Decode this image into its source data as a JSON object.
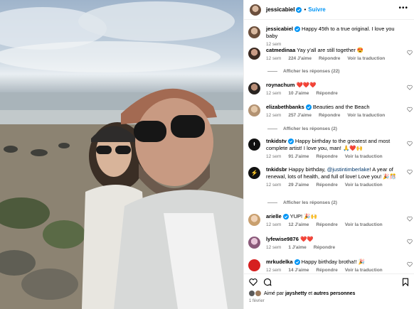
{
  "post": {
    "author": "jessicabiel",
    "follow_label": "Suivre",
    "caption": "Happy 45th to a true original. I love you baby",
    "caption_time": "12 sem"
  },
  "comments": [
    {
      "user": "catmedinaa",
      "text": "Yay y'all are still together 😍",
      "time": "12 sem",
      "likes": "224 J'aime",
      "reply": "Répondre",
      "translate": "Voir la traduction",
      "replies": "Afficher les réponses (22)"
    },
    {
      "user": "roynachum",
      "text": "❤️❤️❤️",
      "time": "12 sem",
      "likes": "10 J'aime",
      "reply": "Répondre",
      "translate": "",
      "replies": ""
    },
    {
      "user": "elizabethbanks",
      "text": "Beauties and the Beach",
      "time": "12 sem",
      "likes": "257 J'aime",
      "reply": "Répondre",
      "translate": "Voir la traduction",
      "replies": "Afficher les réponses (2)"
    },
    {
      "user": "tnkidstv",
      "text": "Happy birthday to the greatest and most complete artist! I love you, man! 🙏❤️🙌",
      "time": "12 sem",
      "likes": "91 J'aime",
      "reply": "Répondre",
      "translate": "Voir la traduction",
      "replies": ""
    },
    {
      "user": "tnkidsbr",
      "mention": "@justintimberlake",
      "text_pre": "Happy birthday, ",
      "text": "! A year of renewal, lots of health, and full of love! Love you! 🎉🎊",
      "time": "12 sem",
      "likes": "29 J'aime",
      "reply": "Répondre",
      "translate": "Voir la traduction",
      "replies": "Afficher les réponses (2)"
    },
    {
      "user": "arielle",
      "text": "YUP! 🎉🙌",
      "time": "12 sem",
      "likes": "12 J'aime",
      "reply": "Répondre",
      "translate": "Voir la traduction",
      "replies": ""
    },
    {
      "user": "lyfewise9876",
      "text": "❤️❤️",
      "time": "12 sem",
      "likes": "1 J'aime",
      "reply": "Répondre",
      "translate": "",
      "replies": ""
    },
    {
      "user": "mrkudelka",
      "text": "Happy birthday brotha!! 🎉",
      "time": "12 sem",
      "likes": "14 J'aime",
      "reply": "Répondre",
      "translate": "Voir la traduction",
      "replies": ""
    }
  ],
  "footer": {
    "liked_by_prefix": "Aimé par",
    "liked_by_user": "jayshetty",
    "liked_by_and": "et",
    "liked_by_others": "autres personnes",
    "date": "1 février"
  },
  "icons": {
    "verified": "verified-badge-icon",
    "more": "more-options-icon",
    "heart": "heart-icon",
    "comment": "comment-icon",
    "bookmark": "bookmark-icon"
  },
  "colors": {
    "link": "#0095f6",
    "verified": "#0095f6",
    "muted": "#737373",
    "mention": "#00376b"
  }
}
